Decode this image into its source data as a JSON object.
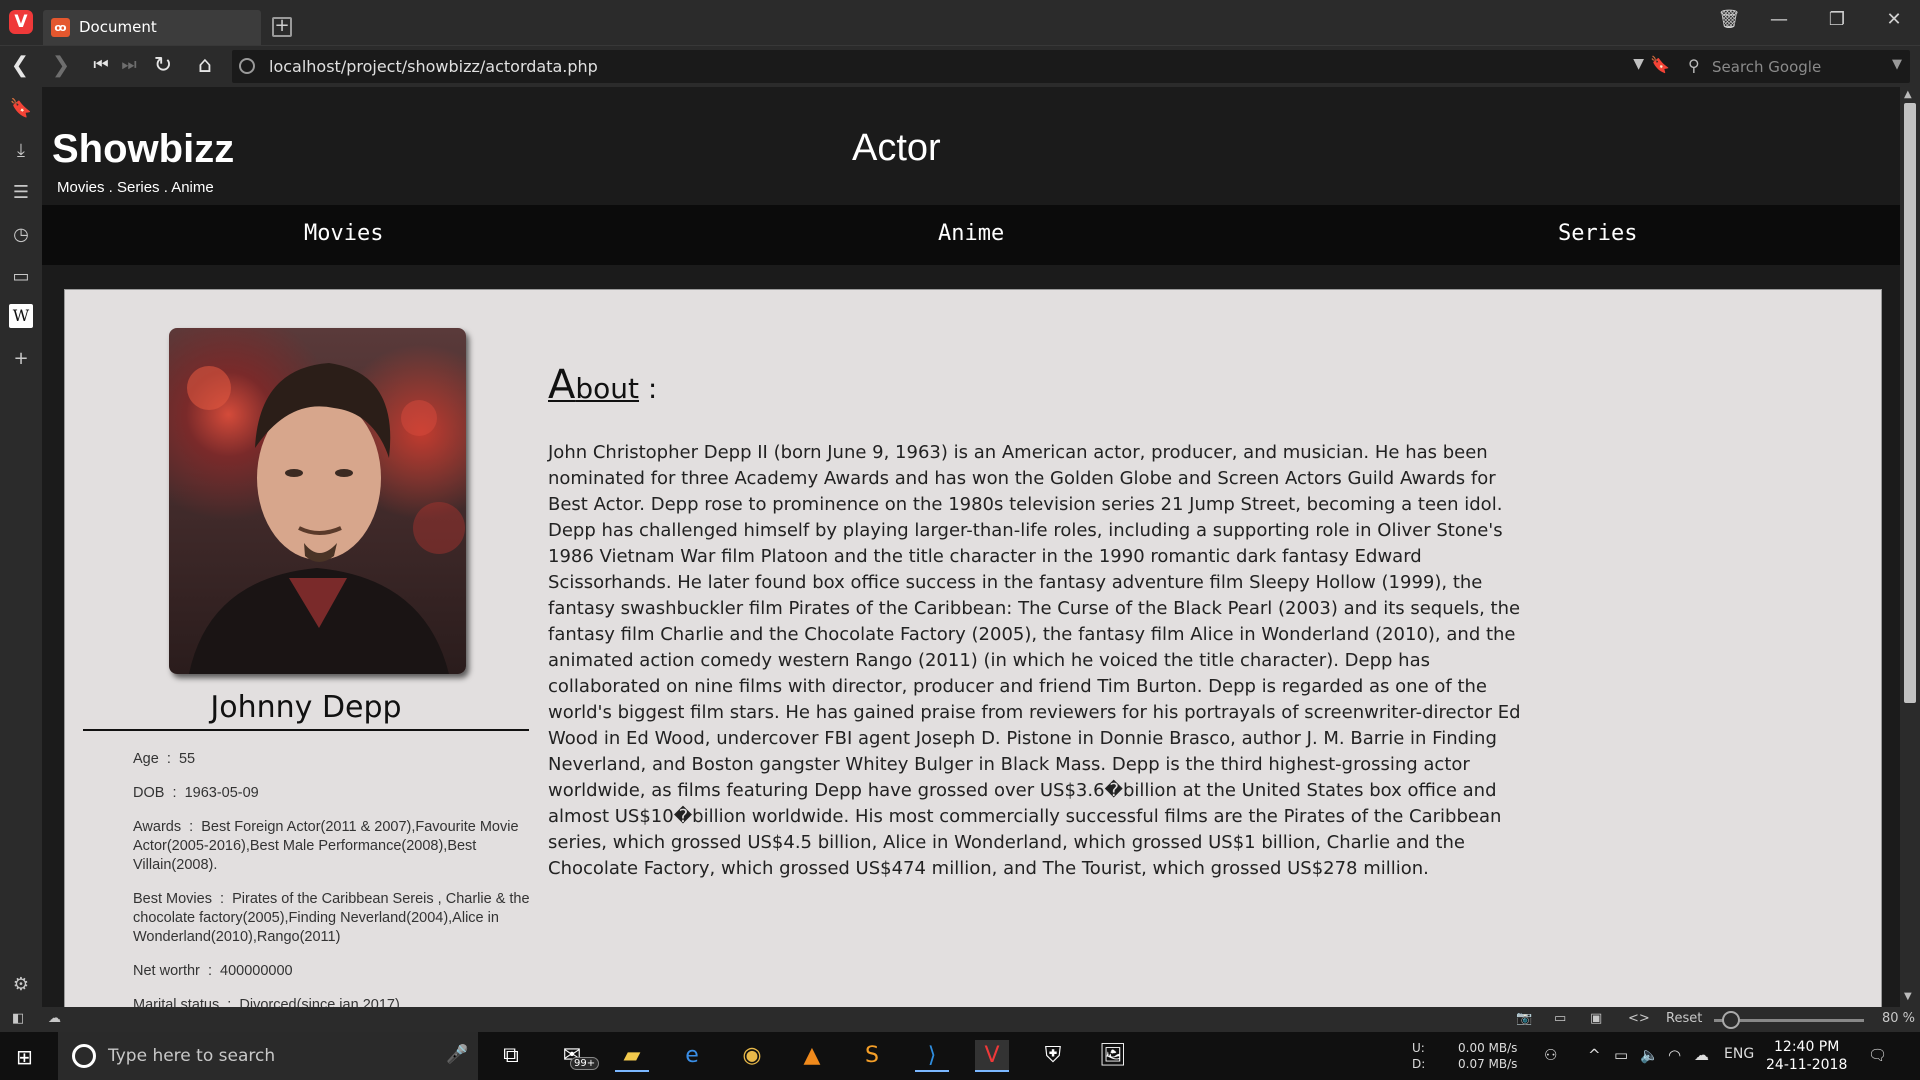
{
  "browser": {
    "tab_title": "Document",
    "url": "localhost/project/showbizz/actordata.php",
    "search_placeholder": "Search Google",
    "zoom_reset_label": "Reset",
    "zoom_level": "80 %"
  },
  "site": {
    "brand": "Showbizz",
    "tagline": "Movies . Series . Anime",
    "page_heading": "Actor",
    "nav": {
      "movies": "Movies",
      "anime": "Anime",
      "series": "Series"
    }
  },
  "actor": {
    "name": "Johnny Depp",
    "facts": [
      {
        "label": "Age",
        "value": "55"
      },
      {
        "label": "DOB",
        "value": "1963-05-09"
      },
      {
        "label": "Awards",
        "value": "Best Foreign Actor(2011 & 2007),Favourite Movie Actor(2005-2016),Best Male Performance(2008),Best Villain(2008)."
      },
      {
        "label": "Best Movies",
        "value": "Pirates of the Caribbean Sereis , Charlie & the chocolate factory(2005),Finding Neverland(2004),Alice in Wonderland(2010),Rango(2011)"
      },
      {
        "label": "Net worthr",
        "value": "400000000"
      },
      {
        "label": "Marital status",
        "value": "Divorced(since jan 2017)"
      }
    ],
    "about_title_first": "A",
    "about_title_rest": "bout",
    "about_title_colon": " :",
    "about_text": "John Christopher Depp II (born June 9, 1963) is an American actor, producer, and musician. He has been nominated for three Academy Awards and has won the Golden Globe and Screen Actors Guild Awards for Best Actor. Depp rose to prominence on the 1980s television series 21 Jump Street, becoming a teen idol. Depp has challenged himself by playing larger-than-life roles, including a supporting role in Oliver Stone's 1986 Vietnam War film Platoon and the title character in the 1990 romantic dark fantasy Edward Scissorhands. He later found box office success in the fantasy adventure film Sleepy Hollow (1999), the fantasy swashbuckler film Pirates of the Caribbean: The Curse of the Black Pearl (2003) and its sequels, the fantasy film Charlie and the Chocolate Factory (2005), the fantasy film Alice in Wonderland (2010), and the animated action comedy western Rango (2011) (in which he voiced the title character). Depp has collaborated on nine films with director, producer and friend Tim Burton. Depp is regarded as one of the world's biggest film stars. He has gained praise from reviewers for his portrayals of screenwriter-director Ed Wood in Ed Wood, undercover FBI agent Joseph D. Pistone in Donnie Brasco, author J. M. Barrie in Finding Neverland, and Boston gangster Whitey Bulger in Black Mass. Depp is the third highest-grossing actor worldwide, as films featuring Depp have grossed over US$3.6�billion at the United States box office and almost US$10�billion worldwide. His most commercially successful films are the Pirates of the Caribbean series, which grossed US$4.5 billion, Alice in Wonderland, which grossed US$1 billion, Charlie and the Chocolate Factory, which grossed US$474 million, and The Tourist, which grossed US$278 million."
  },
  "taskbar": {
    "search_placeholder": "Type here to search",
    "mail_badge": "99+",
    "net_up_label": "U:",
    "net_down_label": "D:",
    "net_up": "0.00 MB/s",
    "net_down": "0.07 MB/s",
    "language": "ENG",
    "time": "12:40 PM",
    "date": "24-11-2018"
  },
  "icons": {
    "browser_logo": "vivaldi-logo",
    "taskbar_apps": [
      "task-view",
      "mail",
      "file-explorer",
      "edge",
      "chrome",
      "vlc",
      "sublime-text",
      "vscode",
      "vivaldi",
      "security",
      "photos"
    ]
  },
  "colors": {
    "brand_red": "#ef3939",
    "page_background": "#1b1b1b",
    "card_background": "#e2dfdf"
  }
}
